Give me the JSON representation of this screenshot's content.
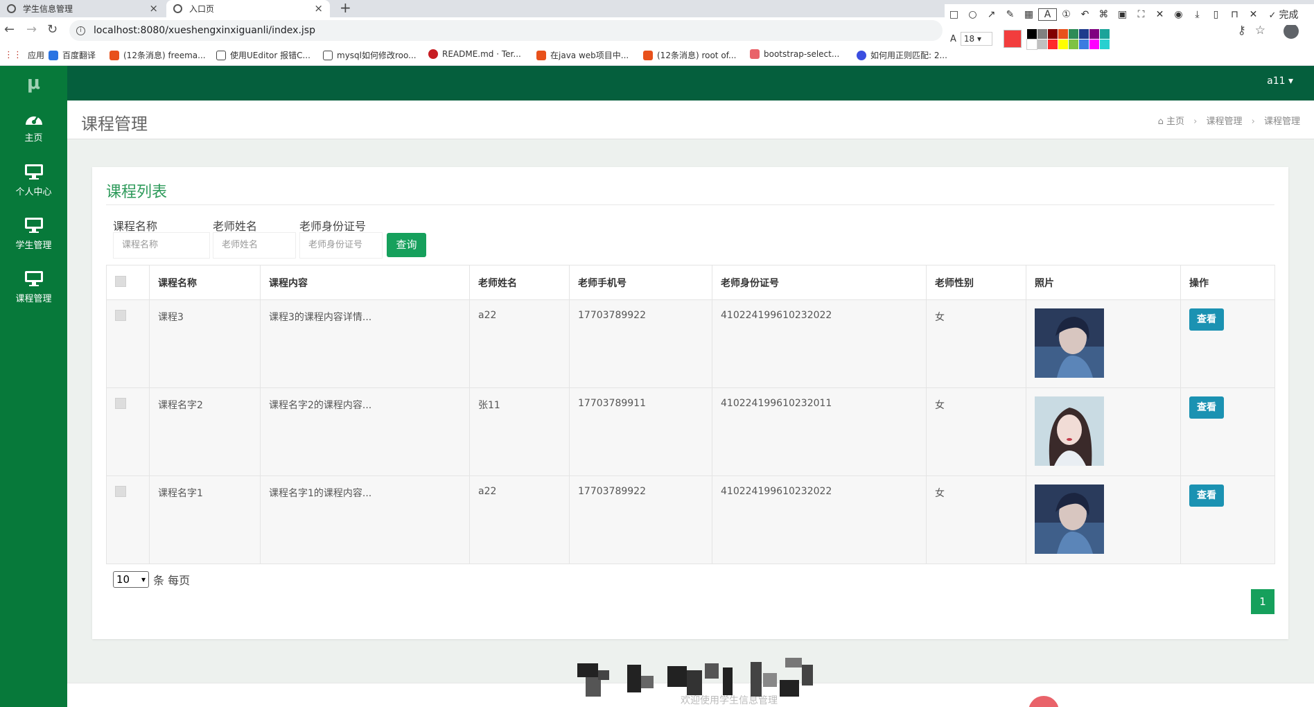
{
  "browser": {
    "tabs": [
      {
        "title": "学生信息管理",
        "active": false
      },
      {
        "title": "入口页",
        "active": true
      }
    ],
    "new_tab": "+",
    "url": "localhost:8080/xueshengxinxiguanli/index.jsp",
    "bookmarks": [
      {
        "label": "应用",
        "color": "#c0392b"
      },
      {
        "label": "百度翻译",
        "color": "#2b74e2"
      },
      {
        "label": "(12条消息) freema...",
        "color": "#e8511b"
      },
      {
        "label": "使用UEditor 报错C...",
        "color": "#444444"
      },
      {
        "label": "mysql如何修改roo...",
        "color": "#444444"
      },
      {
        "label": "README.md · Ter...",
        "color": "#c71d23"
      },
      {
        "label": "在java web项目中...",
        "color": "#e8511b"
      },
      {
        "label": "(12条消息) root of...",
        "color": "#e8511b"
      },
      {
        "label": "bootstrap-select...",
        "color": "#e9636a"
      },
      {
        "label": "如何用正则匹配: 2...",
        "color": "#3b4ee0"
      }
    ]
  },
  "snip_tool": {
    "font_size": "18",
    "done_label": "完成",
    "current_color": "#f23d3d",
    "palette": [
      "#000000",
      "#808080",
      "#800000",
      "#e8511b",
      "#2e8b57",
      "#1f3b8c",
      "#800080",
      "#1aa39a",
      "#ffffff",
      "#c0c0c0",
      "#ff2a2a",
      "#ffff00",
      "#7ec242",
      "#3b7be0",
      "#ff00ff",
      "#27d0d0"
    ]
  },
  "app": {
    "logo": "μ",
    "sidebar": [
      {
        "label": "主页",
        "icon": "dashboard-icon"
      },
      {
        "label": "个人中心",
        "icon": "monitor-icon"
      },
      {
        "label": "学生管理",
        "icon": "monitor-icon"
      },
      {
        "label": "课程管理",
        "icon": "monitor-icon"
      }
    ],
    "user": "a11 ▾",
    "page_title": "课程管理",
    "breadcrumb": [
      "主页",
      "课程管理",
      "课程管理"
    ],
    "panel_title": "课程列表",
    "filters": [
      {
        "label": "课程名称",
        "placeholder": "课程名称"
      },
      {
        "label": "老师姓名",
        "placeholder": "老师姓名"
      },
      {
        "label": "老师身份证号",
        "placeholder": "老师身份证号"
      }
    ],
    "query_button": "查询",
    "columns": [
      "课程名称",
      "课程内容",
      "老师姓名",
      "老师手机号",
      "老师身份证号",
      "老师性别",
      "照片",
      "操作"
    ],
    "rows": [
      {
        "name": "课程3",
        "content": "课程3的课程内容详情...",
        "teacher": "a22",
        "phone": "17703789922",
        "id_no": "410224199610232022",
        "gender": "女",
        "photo": "boy",
        "action": "查看"
      },
      {
        "name": "课程名字2",
        "content": "课程名字2的课程内容...",
        "teacher": "张11",
        "phone": "17703789911",
        "id_no": "410224199610232011",
        "gender": "女",
        "photo": "girl",
        "action": "查看"
      },
      {
        "name": "课程名字1",
        "content": "课程名字1的课程内容...",
        "teacher": "a22",
        "phone": "17703789922",
        "id_no": "410224199610232022",
        "gender": "女",
        "photo": "boy",
        "action": "查看"
      }
    ],
    "page_size": "10",
    "page_size_suffix": "条 每页",
    "current_page": "1",
    "footer": "欢迎使用学生信息管理"
  }
}
